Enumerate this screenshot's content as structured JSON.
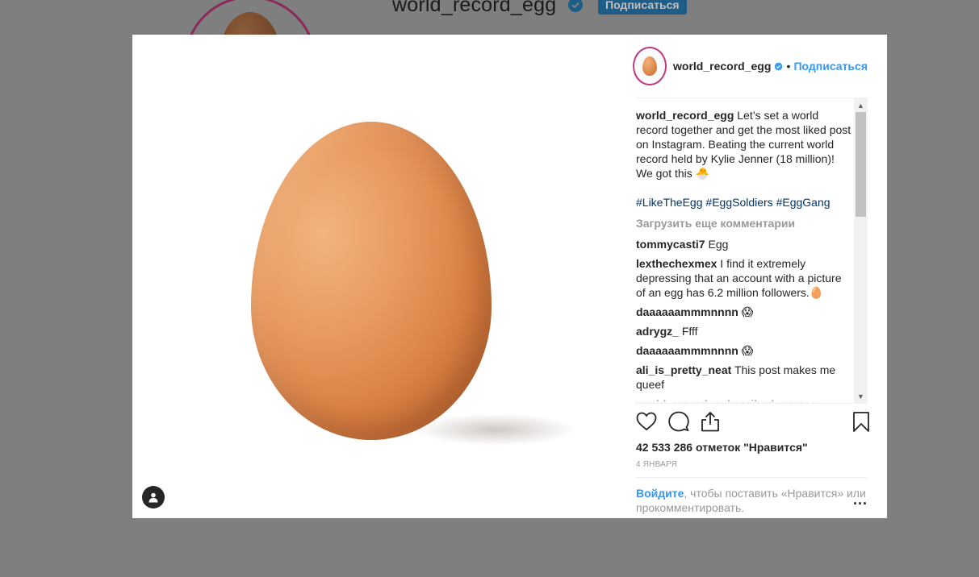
{
  "background_profile": {
    "username": "world_record_egg",
    "follow_label": "Подписаться"
  },
  "post": {
    "header": {
      "username": "world_record_egg",
      "separator": "•",
      "follow_label": "Подписаться"
    },
    "caption": {
      "username": "world_record_egg",
      "text": "Let’s set a world record together and get the most liked post on Instagram. Beating the current world record held by Kylie Jenner (18 million)! We got this 🐣",
      "hashtags": [
        "#LikeTheEgg",
        "#EggSoldiers",
        "#EggGang"
      ]
    },
    "load_more_label": "Загрузить еще комментарии",
    "comments": [
      {
        "username": "tommycasti7",
        "text": "Egg"
      },
      {
        "username": "lexthechexmex",
        "text": "I find it extremely depressing that an account with a picture of an egg has 6.2 million followers.🥚"
      },
      {
        "username": "daaaaaammmnnnn",
        "text": "😱"
      },
      {
        "username": "adrygz_",
        "text": "Ffff"
      },
      {
        "username": "daaaaaammmnnnn",
        "text": "😱"
      },
      {
        "username": "ali_is_pretty_neat",
        "text": "This post makes me queef"
      },
      {
        "username": "world_record_subscribed_person",
        "text": ""
      }
    ],
    "likes_text": "42 533 286 отметок \"Нравится\"",
    "date": "4 января",
    "login_prompt": {
      "link": "Войдите",
      "text": ", чтобы поставить «Нравится» или прокомментировать."
    },
    "more_label": "..."
  },
  "colors": {
    "overlay": "#7f7f7f",
    "link_blue": "#3897f0",
    "hashtag": "#003569",
    "verified": "#3897f0"
  }
}
